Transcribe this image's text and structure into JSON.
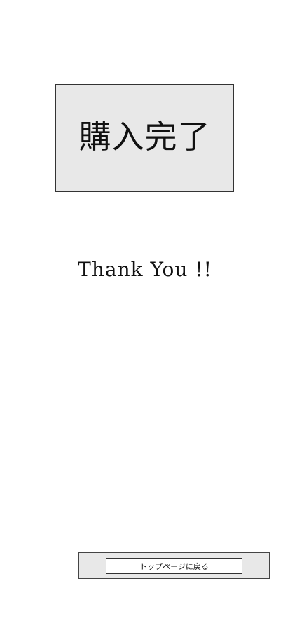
{
  "heading": {
    "title": "購入完了"
  },
  "message": {
    "text": "Thank You !!"
  },
  "footer": {
    "back_button_label": "トップページに戻る"
  },
  "colors": {
    "page_background": "#ffffff",
    "box_background": "#e8e8e8",
    "border": "#333333",
    "text": "#111111"
  }
}
